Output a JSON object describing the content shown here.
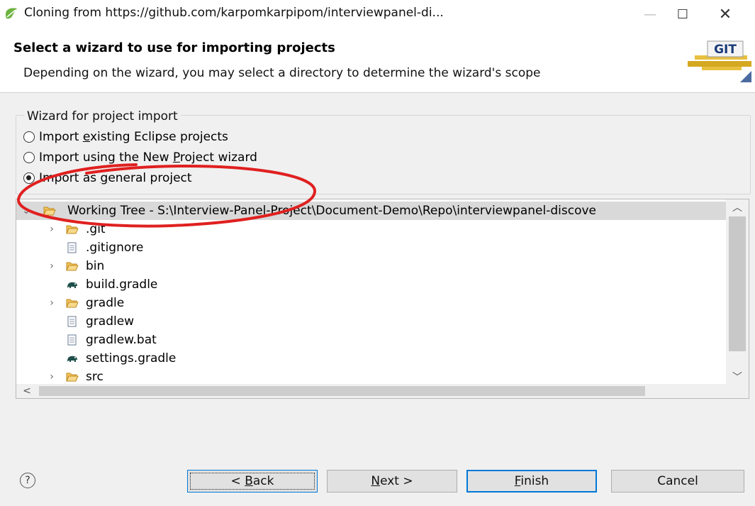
{
  "window": {
    "title": "Cloning from https://github.com/karpomkarpipom/interviewpanel-di...",
    "controls": {
      "minimize": "—",
      "maximize": "☐",
      "close": "✕"
    }
  },
  "header": {
    "title": "Select a wizard to use for importing projects",
    "description": "Depending on the wizard, you may select a directory to determine the wizard's scope",
    "logo_text": "GIT"
  },
  "wizard_group": {
    "label": "Wizard for project import",
    "options": [
      {
        "pre": "Import ",
        "mnemonic": "e",
        "post": "xisting Eclipse projects",
        "checked": false
      },
      {
        "pre": "Import using the New ",
        "mnemonic": "P",
        "post": "roject wizard",
        "checked": false
      },
      {
        "pre": "Import as ",
        "mnemonic": "g",
        "post": "eneral project",
        "checked": true
      }
    ]
  },
  "tree": {
    "root": "Working Tree - S:\\Interview-Panel-Project\\Document-Demo\\Repo\\interviewpanel-discove",
    "items": [
      {
        "label": ".git",
        "type": "folder",
        "expandable": true
      },
      {
        "label": ".gitignore",
        "type": "file",
        "expandable": false
      },
      {
        "label": "bin",
        "type": "folder",
        "expandable": true
      },
      {
        "label": "build.gradle",
        "type": "gradle",
        "expandable": false
      },
      {
        "label": "gradle",
        "type": "folder",
        "expandable": true
      },
      {
        "label": "gradlew",
        "type": "file",
        "expandable": false
      },
      {
        "label": "gradlew.bat",
        "type": "file",
        "expandable": false
      },
      {
        "label": "settings.gradle",
        "type": "gradle",
        "expandable": false
      },
      {
        "label": "src",
        "type": "folder",
        "expandable": true
      }
    ]
  },
  "buttons": {
    "help": "?",
    "back": {
      "pre": "< ",
      "mnemonic": "B",
      "post": "ack"
    },
    "next": {
      "pre": "",
      "mnemonic": "N",
      "post": "ext >"
    },
    "finish": {
      "pre": "",
      "mnemonic": "F",
      "post": "inish"
    },
    "cancel": "Cancel"
  },
  "colors": {
    "accent": "#0078d7",
    "annotation": "#e02020",
    "selection": "#d9d9d9"
  }
}
